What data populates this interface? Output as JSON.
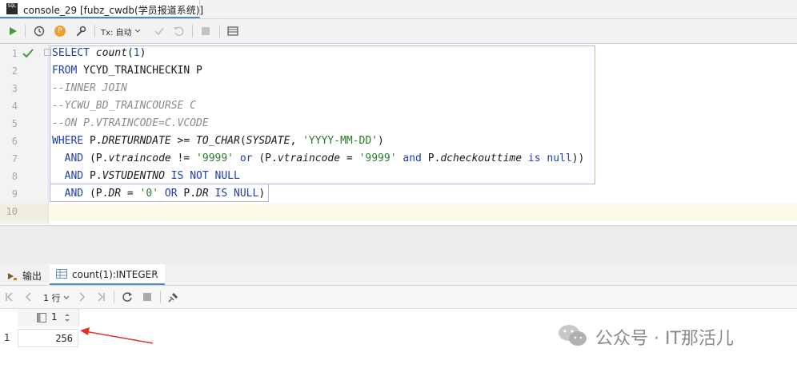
{
  "tab": {
    "title": "console_29 [fubz_cwdb(学员报道系统)]",
    "close_glyph": "×",
    "icon_text": "SQL"
  },
  "toolbar": {
    "run_icon": "play-icon",
    "tx_label": "Tx: 自动",
    "p_label": "P"
  },
  "editor": {
    "line_numbers": [
      "1",
      "2",
      "3",
      "4",
      "5",
      "6",
      "7",
      "8",
      "9",
      "10"
    ],
    "lines": [
      {
        "parts": [
          {
            "t": "SELECT ",
            "c": "kw"
          },
          {
            "t": "count",
            "c": "fn"
          },
          {
            "t": "(",
            "c": ""
          },
          {
            "t": "1",
            "c": "num"
          },
          {
            "t": ")",
            "c": ""
          }
        ]
      },
      {
        "parts": [
          {
            "t": "FROM ",
            "c": "kw"
          },
          {
            "t": "YCYD_TRAINCHECKIN P",
            "c": ""
          }
        ]
      },
      {
        "parts": [
          {
            "t": "--INNER JOIN",
            "c": "cm"
          }
        ]
      },
      {
        "parts": [
          {
            "t": "--YCWU_BD_TRAINCOURSE C",
            "c": "cm"
          }
        ]
      },
      {
        "parts": [
          {
            "t": "--ON P.VTRAINCODE=C.VCODE",
            "c": "cm"
          }
        ]
      },
      {
        "parts": [
          {
            "t": "WHERE ",
            "c": "kw"
          },
          {
            "t": "P.",
            "c": ""
          },
          {
            "t": "DRETURNDATE",
            "c": "fld"
          },
          {
            "t": " >= ",
            "c": ""
          },
          {
            "t": "TO_CHAR",
            "c": "fn"
          },
          {
            "t": "(",
            "c": ""
          },
          {
            "t": "SYSDATE",
            "c": "fld"
          },
          {
            "t": ", ",
            "c": ""
          },
          {
            "t": "'YYYY-MM-DD'",
            "c": "str"
          },
          {
            "t": ")",
            "c": ""
          }
        ]
      },
      {
        "parts": [
          {
            "t": "  AND ",
            "c": "kw"
          },
          {
            "t": "(P.",
            "c": ""
          },
          {
            "t": "vtraincode",
            "c": "fld"
          },
          {
            "t": " != ",
            "c": ""
          },
          {
            "t": "'9999'",
            "c": "str"
          },
          {
            "t": " or ",
            "c": "kw"
          },
          {
            "t": "(P.",
            "c": ""
          },
          {
            "t": "vtraincode",
            "c": "fld"
          },
          {
            "t": " = ",
            "c": ""
          },
          {
            "t": "'9999'",
            "c": "str"
          },
          {
            "t": " and ",
            "c": "kw"
          },
          {
            "t": "P.",
            "c": ""
          },
          {
            "t": "dcheckouttime",
            "c": "fld"
          },
          {
            "t": " is null",
            "c": "kw"
          },
          {
            "t": "))",
            "c": ""
          }
        ]
      },
      {
        "parts": [
          {
            "t": "  AND ",
            "c": "kw"
          },
          {
            "t": "P.",
            "c": ""
          },
          {
            "t": "VSTUDENTNO",
            "c": "fld"
          },
          {
            "t": " IS NOT NULL",
            "c": "kw"
          }
        ]
      },
      {
        "parts": [
          {
            "t": "  AND ",
            "c": "kw"
          },
          {
            "t": "(P.",
            "c": ""
          },
          {
            "t": "DR",
            "c": "fld"
          },
          {
            "t": " = ",
            "c": ""
          },
          {
            "t": "'0'",
            "c": "str"
          },
          {
            "t": " OR ",
            "c": "kw"
          },
          {
            "t": "P.",
            "c": ""
          },
          {
            "t": "DR",
            "c": "fld"
          },
          {
            "t": " IS NULL",
            "c": "kw"
          },
          {
            "t": ")",
            "c": ""
          }
        ]
      },
      {
        "parts": []
      }
    ]
  },
  "results": {
    "tab_output": "输出",
    "tab_result": "count(1):INTEGER",
    "tab_close": "×",
    "rows_label": "1 行",
    "column_header": "1",
    "row_number": "1",
    "value": "256"
  },
  "watermark": {
    "text": "公众号 · IT那活儿"
  },
  "colors": {
    "keyword": "#1f3cae",
    "string": "#2a7a2a",
    "comment": "#8c8c8c",
    "run_green": "#3d9c3d",
    "arrow_red": "#e0302a"
  }
}
